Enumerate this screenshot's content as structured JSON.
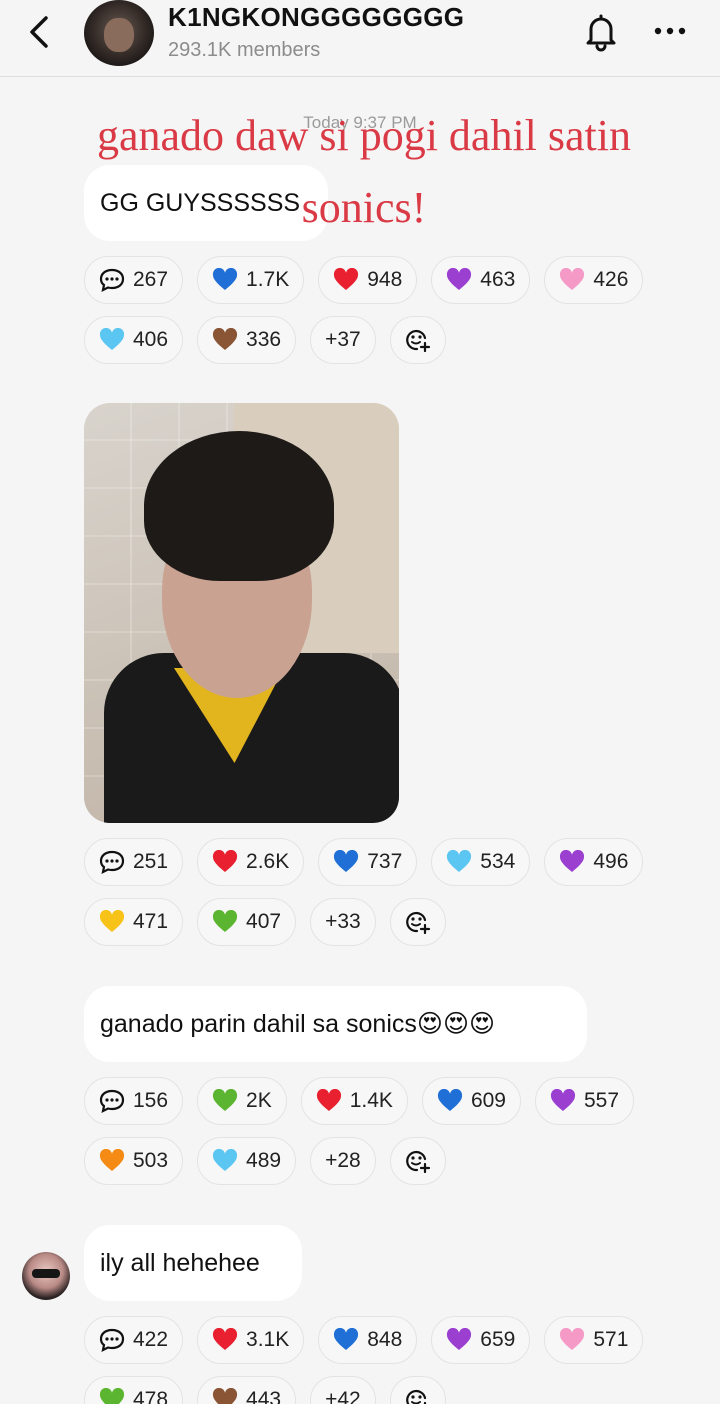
{
  "header": {
    "group_name": "K1NGKONGGGGGGGG",
    "members": "293.1K members",
    "icons": [
      "back-icon",
      "bell-icon",
      "more-icon"
    ]
  },
  "timestamp": "Today 9:37 PM",
  "overlay_caption": "ganado daw si pogi dahil satin sonics!",
  "messages": [
    {
      "text": "GG GUYSSSSSS",
      "reactions_row1": [
        {
          "icon": "comment",
          "count": "267"
        },
        {
          "icon": "blue-heart",
          "count": "1.7K"
        },
        {
          "icon": "red-heart",
          "count": "948"
        },
        {
          "icon": "purple-heart",
          "count": "463"
        },
        {
          "icon": "pink-heart",
          "count": "426"
        }
      ],
      "reactions_row2": [
        {
          "icon": "light-blue-heart",
          "count": "406"
        },
        {
          "icon": "brown-heart",
          "count": "336"
        },
        {
          "icon": "none",
          "count": "+37"
        },
        {
          "icon": "add-reaction",
          "count": ""
        }
      ]
    },
    {
      "text": "",
      "reactions_row1": [
        {
          "icon": "comment",
          "count": "251"
        },
        {
          "icon": "red-heart",
          "count": "2.6K"
        },
        {
          "icon": "blue-heart",
          "count": "737"
        },
        {
          "icon": "light-blue-heart",
          "count": "534"
        },
        {
          "icon": "purple-heart",
          "count": "496"
        }
      ],
      "reactions_row2": [
        {
          "icon": "yellow-heart",
          "count": "471"
        },
        {
          "icon": "green-heart",
          "count": "407"
        },
        {
          "icon": "none",
          "count": "+33"
        },
        {
          "icon": "add-reaction",
          "count": ""
        }
      ]
    },
    {
      "text": "ganado parin dahil sa sonics😍😍😍",
      "reactions_row1": [
        {
          "icon": "comment",
          "count": "156"
        },
        {
          "icon": "green-heart",
          "count": "2K"
        },
        {
          "icon": "red-heart",
          "count": "1.4K"
        },
        {
          "icon": "blue-heart",
          "count": "609"
        },
        {
          "icon": "purple-heart",
          "count": "557"
        }
      ],
      "reactions_row2": [
        {
          "icon": "orange-heart",
          "count": "503"
        },
        {
          "icon": "light-blue-heart",
          "count": "489"
        },
        {
          "icon": "none",
          "count": "+28"
        },
        {
          "icon": "add-reaction",
          "count": ""
        }
      ]
    },
    {
      "text": "ily all hehehee",
      "reactions_row1": [
        {
          "icon": "comment",
          "count": "422"
        },
        {
          "icon": "red-heart",
          "count": "3.1K"
        },
        {
          "icon": "blue-heart",
          "count": "848"
        },
        {
          "icon": "purple-heart",
          "count": "659"
        },
        {
          "icon": "pink-heart",
          "count": "571"
        }
      ],
      "reactions_row2": [
        {
          "icon": "green-heart",
          "count": "478"
        },
        {
          "icon": "brown-heart",
          "count": "443"
        },
        {
          "icon": "none",
          "count": "+42"
        },
        {
          "icon": "add-reaction",
          "count": ""
        }
      ]
    }
  ],
  "colors": {
    "background": "#f5f5f5",
    "bubble": "#ffffff",
    "overlay_caption": "#d9303c",
    "red-heart": "#e8202f",
    "blue-heart": "#1f6fd6",
    "light-blue-heart": "#5cc6f2",
    "purple-heart": "#9a3fd0",
    "pink-heart": "#f59ac6",
    "brown-heart": "#8a5534",
    "yellow-heart": "#f7c318",
    "green-heart": "#5cb531",
    "orange-heart": "#f58a14"
  }
}
